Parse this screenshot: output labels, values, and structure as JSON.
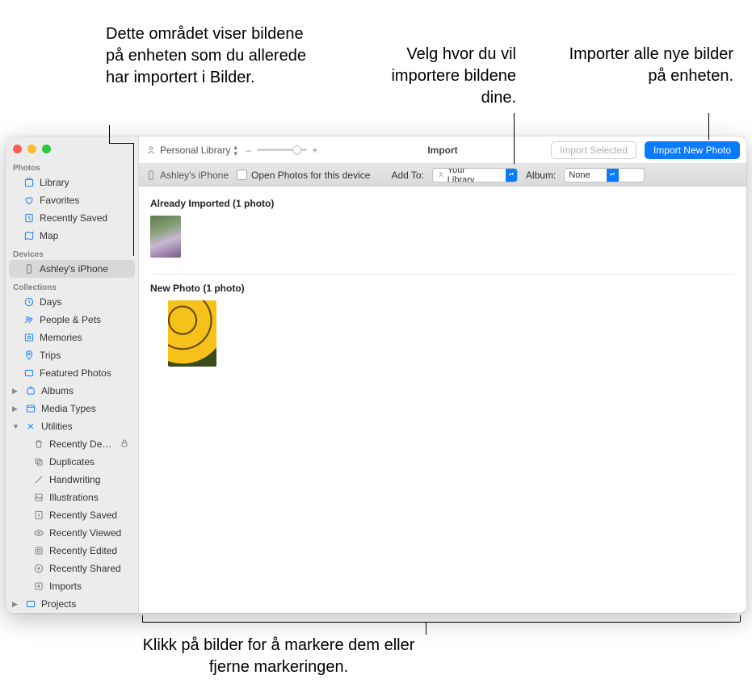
{
  "callouts": {
    "already_imported": "Dette området viser bildene på enheten som du allerede har importert i Bilder.",
    "choose_destination": "Velg hvor du vil importere bildene dine.",
    "import_all": "Importer alle nye bilder på enheten.",
    "select_photos": "Klikk på bilder for å markere dem eller fjerne markeringen."
  },
  "sidebar": {
    "sections": {
      "photos": "Photos",
      "devices": "Devices",
      "collections": "Collections"
    },
    "items": {
      "library": "Library",
      "favorites": "Favorites",
      "recently_saved": "Recently Saved",
      "map": "Map",
      "device": "Ashley's iPhone",
      "days": "Days",
      "people_pets": "People & Pets",
      "memories": "Memories",
      "trips": "Trips",
      "featured_photos": "Featured Photos",
      "albums": "Albums",
      "media_types": "Media Types",
      "utilities": "Utilities",
      "recently_deleted": "Recently Deleted",
      "duplicates": "Duplicates",
      "handwriting": "Handwriting",
      "illustrations": "Illustrations",
      "recently_saved2": "Recently Saved",
      "recently_viewed": "Recently Viewed",
      "recently_edited": "Recently Edited",
      "recently_shared": "Recently Shared",
      "imports": "Imports",
      "projects": "Projects"
    }
  },
  "toolbar": {
    "library_popup": "Personal Library",
    "zoom": {
      "minus": "–",
      "plus": "+"
    },
    "title": "Import",
    "import_selected": "Import Selected",
    "import_new": "Import New Photo"
  },
  "subbar": {
    "device_name": "Ashley's iPhone",
    "open_photos": "Open Photos for this device",
    "add_to_label": "Add To:",
    "add_to_value": "Your Library",
    "album_label": "Album:",
    "album_value": "None"
  },
  "content": {
    "already_imported_header": "Already Imported (1 photo)",
    "new_photo_header": "New Photo (1 photo)"
  }
}
